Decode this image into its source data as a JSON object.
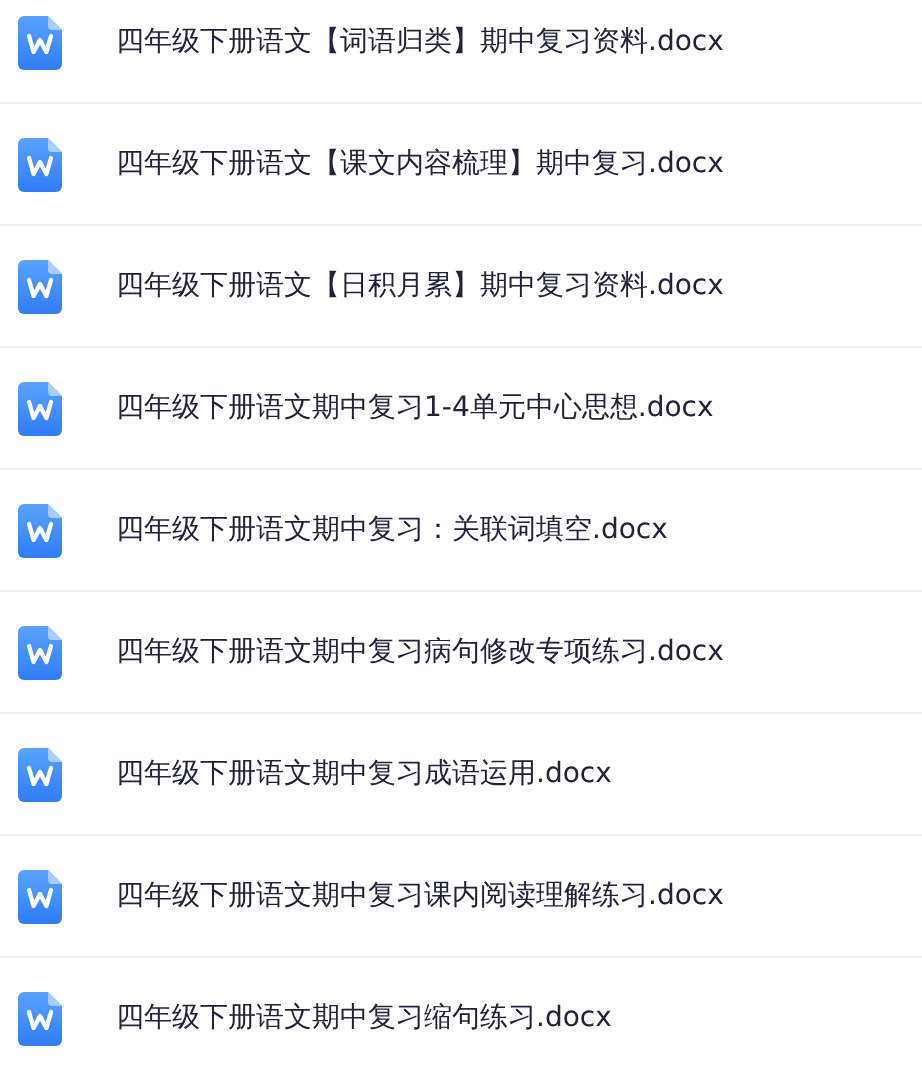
{
  "files": [
    {
      "name": "四年级下册语文【词语归类】期中复习资料.docx"
    },
    {
      "name": "四年级下册语文【课文内容梳理】期中复习.docx"
    },
    {
      "name": "四年级下册语文【日积月累】期中复习资料.docx"
    },
    {
      "name": "四年级下册语文期中复习1-4单元中心思想.docx"
    },
    {
      "name": "四年级下册语文期中复习：关联词填空.docx"
    },
    {
      "name": "四年级下册语文期中复习病句修改专项练习.docx"
    },
    {
      "name": "四年级下册语文期中复习成语运用.docx"
    },
    {
      "name": "四年级下册语文期中复习课内阅读理解练习.docx"
    },
    {
      "name": "四年级下册语文期中复习缩句练习.docx"
    }
  ]
}
